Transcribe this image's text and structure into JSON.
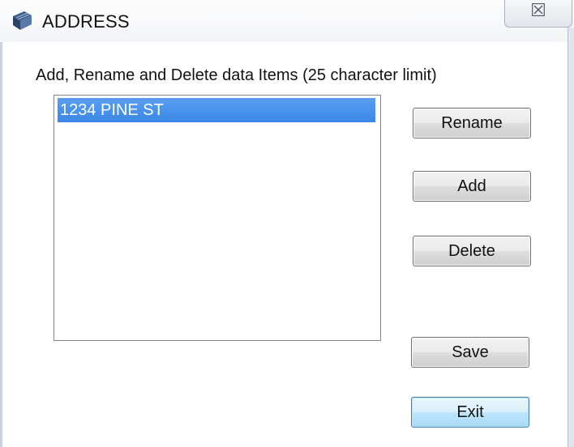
{
  "window": {
    "title": "ADDRESS",
    "close_glyph": "☒"
  },
  "icons": {
    "app": "app-icon",
    "close": "close-icon"
  },
  "main": {
    "instruction": "Add, Rename and Delete data Items (25 character limit)",
    "list_items": [
      "1234 PINE ST"
    ]
  },
  "buttons": {
    "rename": "Rename",
    "add": "Add",
    "delete": "Delete",
    "save": "Save",
    "exit": "Exit"
  },
  "colors": {
    "selection": "#3a86e8",
    "default_button_border": "#3c7fb1"
  }
}
